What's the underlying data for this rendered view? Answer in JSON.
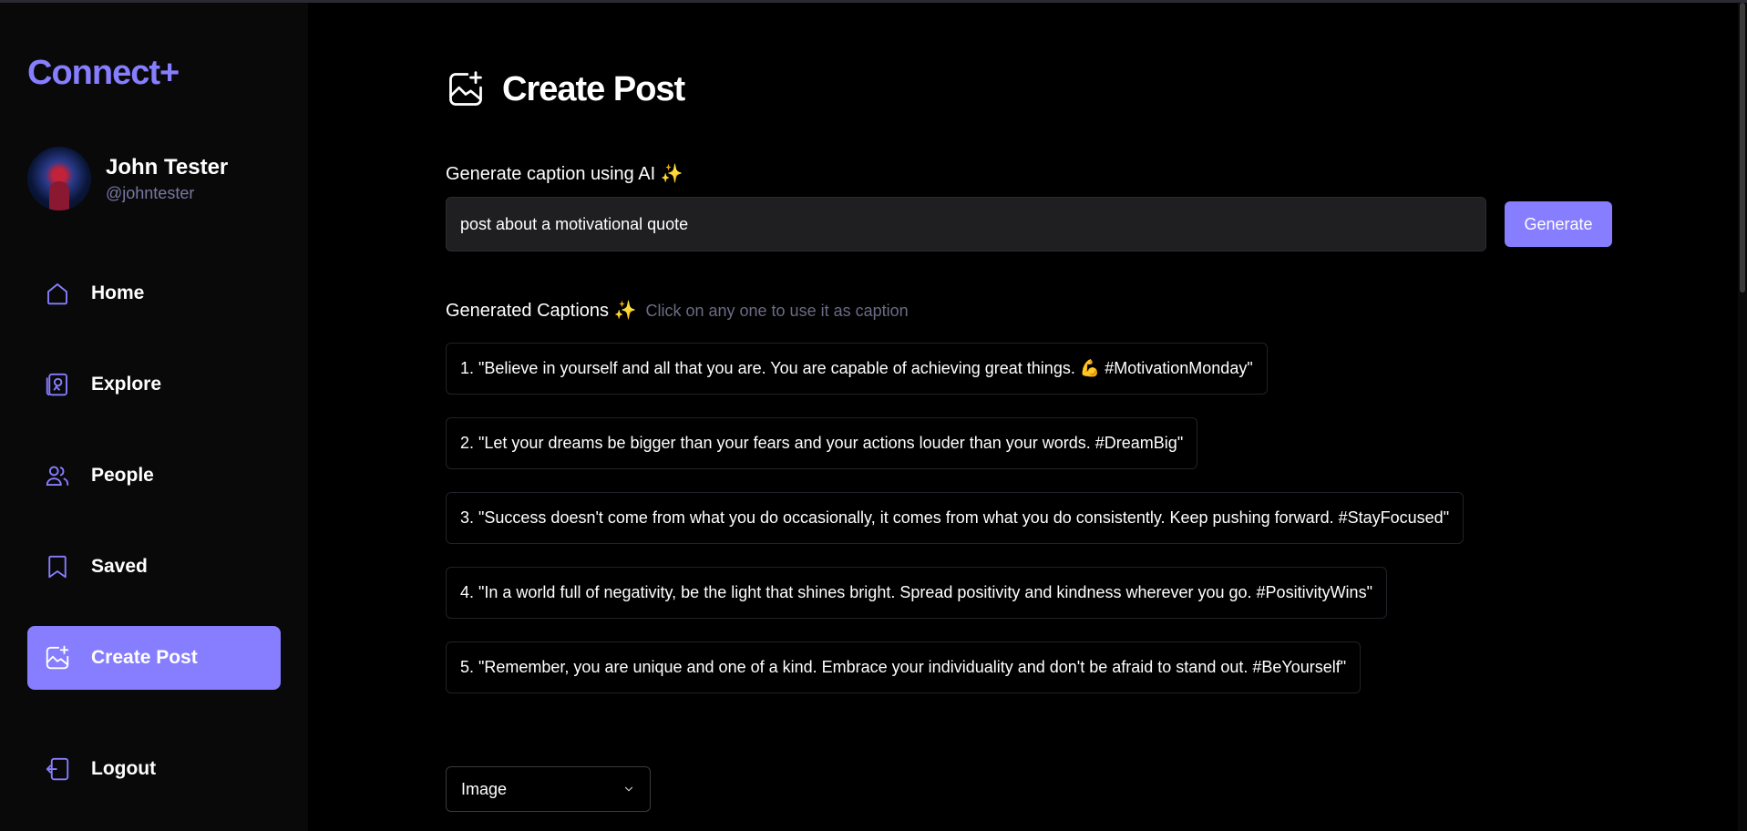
{
  "app": {
    "logo": "Connect+"
  },
  "profile": {
    "name": "John Tester",
    "handle": "@johntester"
  },
  "nav": {
    "home": "Home",
    "explore": "Explore",
    "people": "People",
    "saved": "Saved",
    "create_post": "Create Post",
    "logout": "Logout"
  },
  "page": {
    "title": "Create Post"
  },
  "ai": {
    "label": "Generate caption using AI ✨",
    "input_value": "post about a motivational quote",
    "button": "Generate"
  },
  "generated": {
    "title": "Generated Captions ✨",
    "hint": "Click on any one to use it as caption",
    "captions": [
      "1. \"Believe in yourself and all that you are. You are capable of achieving great things. 💪 #MotivationMonday\"",
      "2. \"Let your dreams be bigger than your fears and your actions louder than your words. #DreamBig\"",
      "3. \"Success doesn't come from what you do occasionally, it comes from what you do consistently. Keep pushing forward. #StayFocused\"",
      "4. \"In a world full of negativity, be the light that shines bright. Spread positivity and kindness wherever you go. #PositivityWins\"",
      "5. \"Remember, you are unique and one of a kind. Embrace your individuality and don't be afraid to stand out. #BeYourself\""
    ]
  },
  "media_select": {
    "selected": "Image"
  },
  "colors": {
    "accent": "#877eff",
    "sidebar_bg": "#09090a",
    "page_bg": "#000000"
  }
}
